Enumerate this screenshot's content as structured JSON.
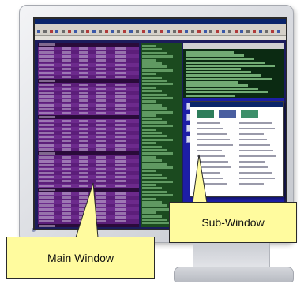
{
  "callouts": {
    "sub_window": "Sub-Window",
    "main_window": "Main Window"
  },
  "colors": {
    "callout_fill": "#fffb9e",
    "main_panel": "#5c1e7a",
    "desktop": "#1d1ea6",
    "title_bar": "#0a246a"
  },
  "icons": [
    "monitor-stand-icon",
    "desktop-icon"
  ]
}
